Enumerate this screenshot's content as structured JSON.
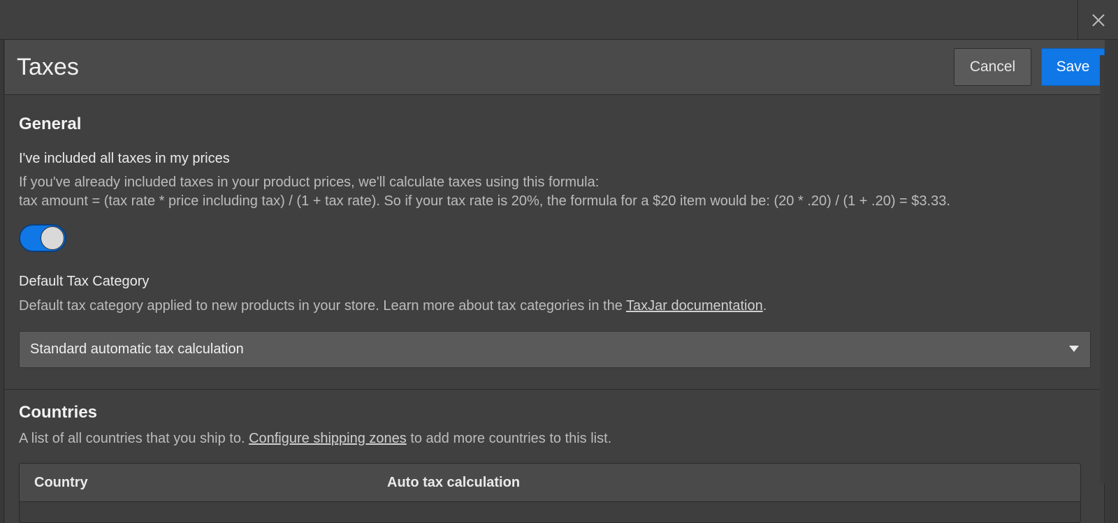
{
  "window": {
    "close_icon": "close-icon"
  },
  "header": {
    "title": "Taxes",
    "cancel_label": "Cancel",
    "save_label": "Save"
  },
  "general": {
    "title": "General",
    "include_taxes_label": "I've included all taxes in my prices",
    "include_taxes_help_line1": "If you've already included taxes in your product prices, we'll calculate taxes using this formula:",
    "include_taxes_help_line2": "tax amount = (tax rate * price including tax) / (1 + tax rate). So if your tax rate is 20%, the formula for a $20 item would be: (20 * .20) / (1 + .20) = $3.33.",
    "include_taxes_enabled": true,
    "default_category_label": "Default Tax Category",
    "default_category_help_prefix": "Default tax category applied to new products in your store. Learn more about tax categories in the ",
    "default_category_help_link": "TaxJar documentation",
    "default_category_help_suffix": ".",
    "default_category_value": "Standard automatic tax calculation"
  },
  "countries": {
    "title": "Countries",
    "help_prefix": "A list of all countries that you ship to. ",
    "help_link": "Configure shipping zones",
    "help_suffix": " to add more countries to this list.",
    "columns": [
      "Country",
      "Auto tax calculation"
    ]
  },
  "colors": {
    "accent": "#1077e6",
    "background": "#404040",
    "header_bg": "#4a4a4a"
  }
}
